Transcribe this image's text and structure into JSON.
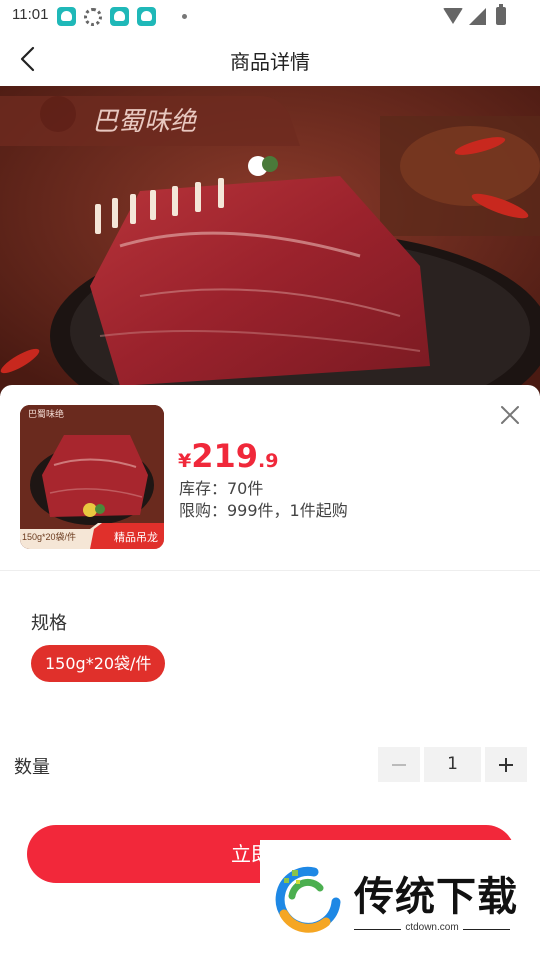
{
  "status_bar": {
    "time": "11:01"
  },
  "header": {
    "title": "商品详情"
  },
  "hero": {
    "brand_logo_text": "巴蜀味绝"
  },
  "product": {
    "thumb_logo_text": "巴蜀味绝",
    "thumb_spec_text": "150g*20袋/件",
    "thumb_badge": "精品吊龙",
    "price_symbol": "¥",
    "price_integer": "219",
    "price_decimal": ".9",
    "stock": "库存：70件",
    "limit": "限购：999件，1件起购"
  },
  "spec": {
    "title": "规格",
    "selected": "150g*20袋/件"
  },
  "quantity": {
    "label": "数量",
    "value": "1"
  },
  "buy_button": {
    "label": "立即购买"
  },
  "watermark": {
    "text": "传统下载",
    "url": "ctdown.com"
  },
  "colors": {
    "accent": "#f2283a",
    "chip": "#e0302b",
    "hero_bg": "#7a2f22"
  }
}
